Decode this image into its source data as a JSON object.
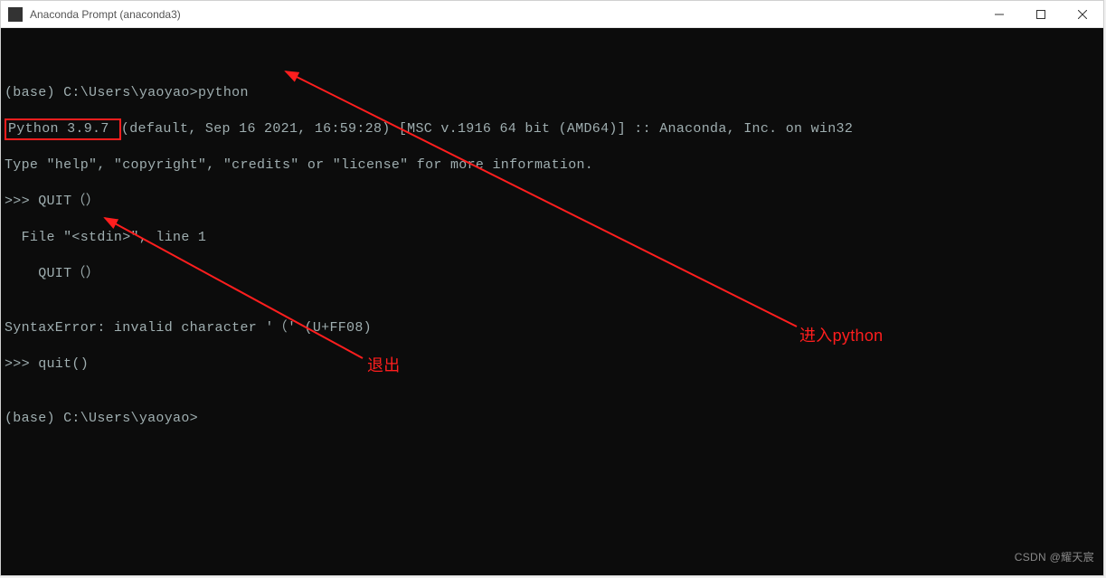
{
  "window": {
    "title": "Anaconda Prompt (anaconda3)"
  },
  "terminal": {
    "line1_prefix": "(base) C:\\Users\\yaoyao>",
    "line1_cmd": "python",
    "line2_highlight": "Python 3.9.7 ",
    "line2_rest": "(default, Sep 16 2021, 16:59:28) [MSC v.1916 64 bit (AMD64)] :: Anaconda, Inc. on win32",
    "line3": "Type \"help\", \"copyright\", \"credits\" or \"license\" for more information.",
    "line4": ">>> QUIT（）",
    "line5": "  File \"<stdin>\", line 1",
    "line6": "    QUIT（）",
    "line7": "",
    "line8": "SyntaxError: invalid character '（' (U+FF08)",
    "line9": ">>> quit()",
    "line10": "",
    "line11": "(base) C:\\Users\\yaoyao>"
  },
  "annotations": {
    "enter": "进入python",
    "exit": "退出"
  },
  "watermark": "CSDN @耀天宸"
}
